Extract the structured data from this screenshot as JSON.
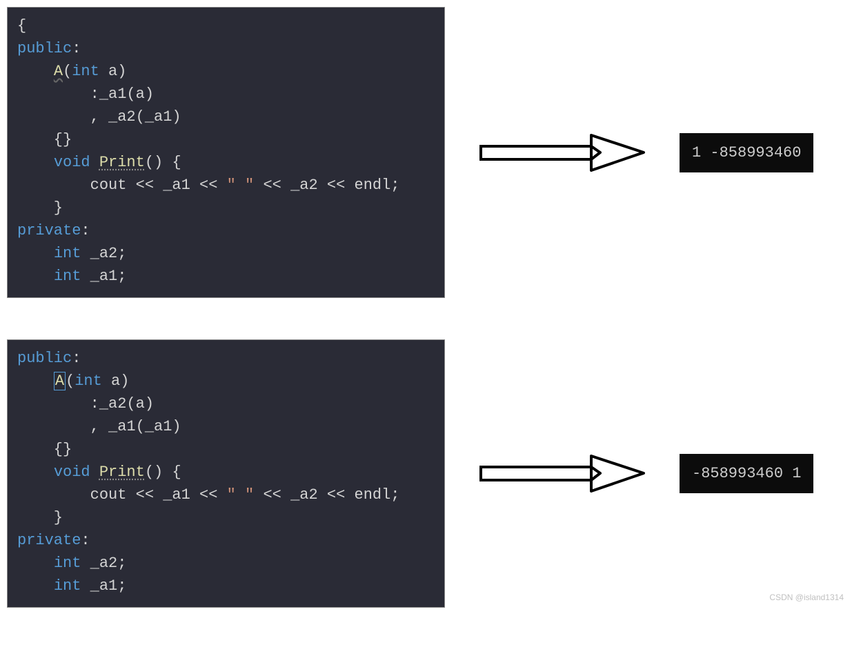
{
  "block1": {
    "l0": "{",
    "l1_public": "public",
    "l1_colon": ":",
    "l2_A": "A",
    "l2_paren_open": "(",
    "l2_int": "int",
    "l2_a": " a",
    "l2_paren_close": ")",
    "l3": "        :_a1(a)",
    "l4": "        , _a2(_a1)",
    "l5": "    {}",
    "l6_void": "void",
    "l6_sp": " ",
    "l6_Print": "Print",
    "l6_rest": "() {",
    "l7_pre": "        cout << _a1 << ",
    "l7_str": "\" \"",
    "l7_post": " << _a2 << endl;",
    "l8": "    }",
    "l9_private": "private",
    "l9_colon": ":",
    "l10_int": "int",
    "l10_rest": " _a2;",
    "l11_int": "int",
    "l11_rest": " _a1;"
  },
  "output1": "1 -858993460",
  "block2": {
    "l1_public": "public",
    "l1_colon": ":",
    "l2_A": "A",
    "l2_paren_open": "(",
    "l2_int": "int",
    "l2_a": " a",
    "l2_paren_close": ")",
    "l3": "        :_a2(a)",
    "l4": "        , _a1(_a1)",
    "l5": "    {}",
    "l6_void": "void",
    "l6_sp": " ",
    "l6_Print": "Print",
    "l6_rest": "() {",
    "l7_pre": "        cout << _a1 << ",
    "l7_str": "\" \"",
    "l7_post": " << _a2 << endl;",
    "l8": "    }",
    "l9_private": "private",
    "l9_colon": ":",
    "l10_int": "int",
    "l10_rest": " _a2;",
    "l11_int": "int",
    "l11_rest": " _a1;"
  },
  "output2": "-858993460 1",
  "watermark": "CSDN @island1314"
}
